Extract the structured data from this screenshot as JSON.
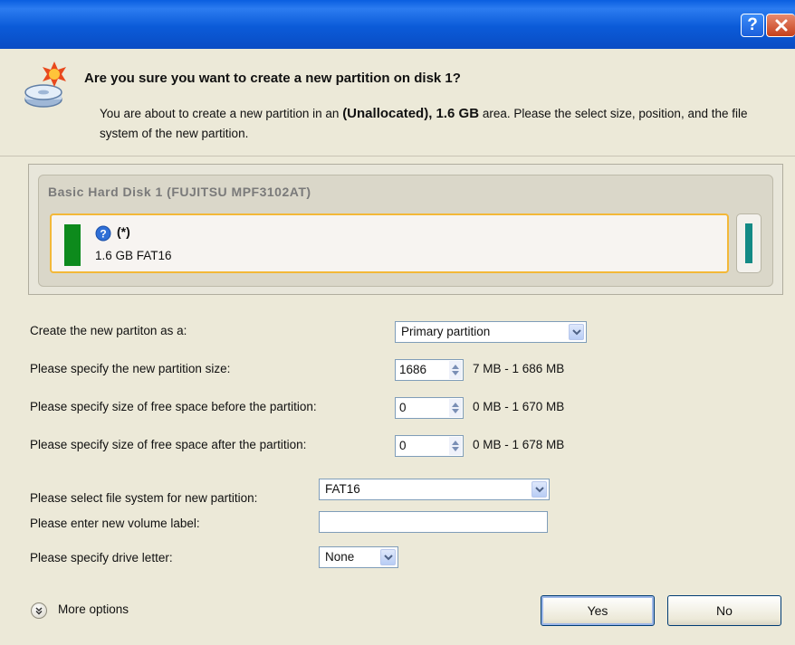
{
  "window": {
    "help_button": "?"
  },
  "header": {
    "question": "Are you sure you want to create a new partition on disk 1?",
    "desc_pre": "You are about to create a new partition in an ",
    "desc_bold": "(Unallocated), 1.6 GB",
    "desc_post": " area. Please the select size, position, and the file system of the new partition."
  },
  "disk": {
    "title": "Basic Hard Disk 1 (FUJITSU MPF3102AT)",
    "partition_name": "(*)",
    "partition_info": "1.6 GB FAT16",
    "partition_color": "#0d8a1c",
    "small_partition_color": "#138a85",
    "selection_border_color": "#f3b838"
  },
  "form": {
    "create_as_label": "Create the new partiton as a:",
    "create_as_value": "Primary partition",
    "size_label": "Please specify the new partition size:",
    "size_value": "1686",
    "size_range": "7 MB - 1 686 MB",
    "before_label": "Please specify size of free space before the partition:",
    "before_value": "0",
    "before_range": "0 MB - 1 670 MB",
    "after_label": "Please specify size of free space after the partition:",
    "after_value": "0",
    "after_range": "0 MB - 1 678 MB",
    "fs_label": "Please select file system for new partition:",
    "fs_value": "FAT16",
    "volume_label": "Please enter new volume label:",
    "volume_value": "",
    "drive_label": "Please specify drive letter:",
    "drive_value": "None"
  },
  "footer": {
    "more_options": "More options",
    "yes": "Yes",
    "no": "No"
  },
  "icons": {
    "help": "help-icon",
    "close": "close-icon",
    "disk_star": "disk-new-partition-icon",
    "info": "question-circle-icon",
    "expand": "double-chevron-down-icon"
  }
}
